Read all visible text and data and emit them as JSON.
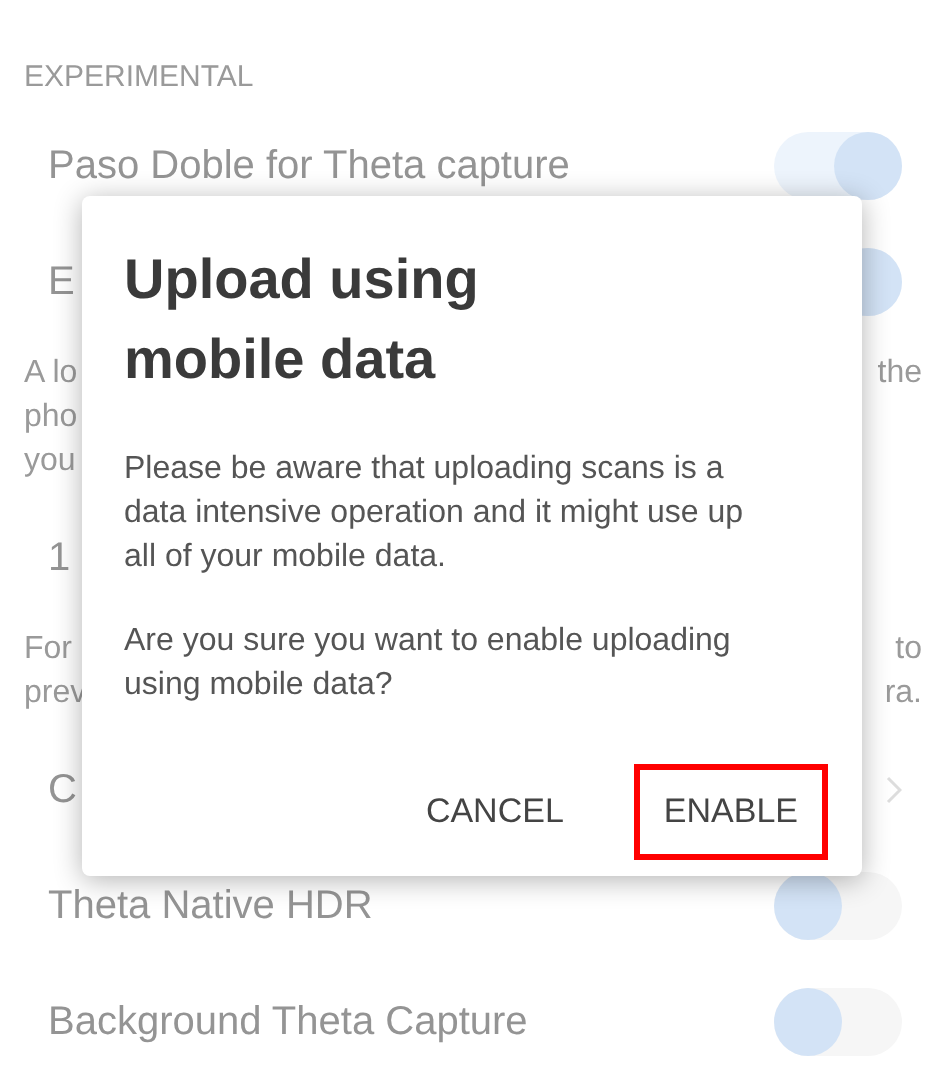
{
  "section_header": "EXPERIMENTAL",
  "rows": [
    {
      "kind": "toggle",
      "label": "Paso Doble for Theta capture",
      "on": true
    },
    {
      "kind": "toggle",
      "label": "E",
      "on": true
    },
    {
      "kind": "note",
      "lines": [
        {
          "left": "A lo",
          "right": "the"
        },
        {
          "left": "pho"
        },
        {
          "left": "you"
        }
      ]
    },
    {
      "kind": "value",
      "label": "1"
    },
    {
      "kind": "note",
      "lines": [
        {
          "left": "For",
          "right": "to"
        },
        {
          "left": "prev",
          "right": "ra."
        }
      ]
    },
    {
      "kind": "link",
      "label": "C"
    },
    {
      "kind": "toggle",
      "label": "Theta Native HDR",
      "on": false
    },
    {
      "kind": "toggle",
      "label": "Background Theta Capture",
      "on": false
    }
  ],
  "dialog": {
    "title": "Upload using mobile data",
    "paragraphs": [
      "Please be aware that uploading scans is a data intensive operation and it might use up all of your mobile data.",
      "Are you sure you want to enable uploading using mobile data?"
    ],
    "buttons": [
      {
        "label": "CANCEL",
        "highlighted": false
      },
      {
        "label": "ENABLE",
        "highlighted": true
      }
    ]
  }
}
